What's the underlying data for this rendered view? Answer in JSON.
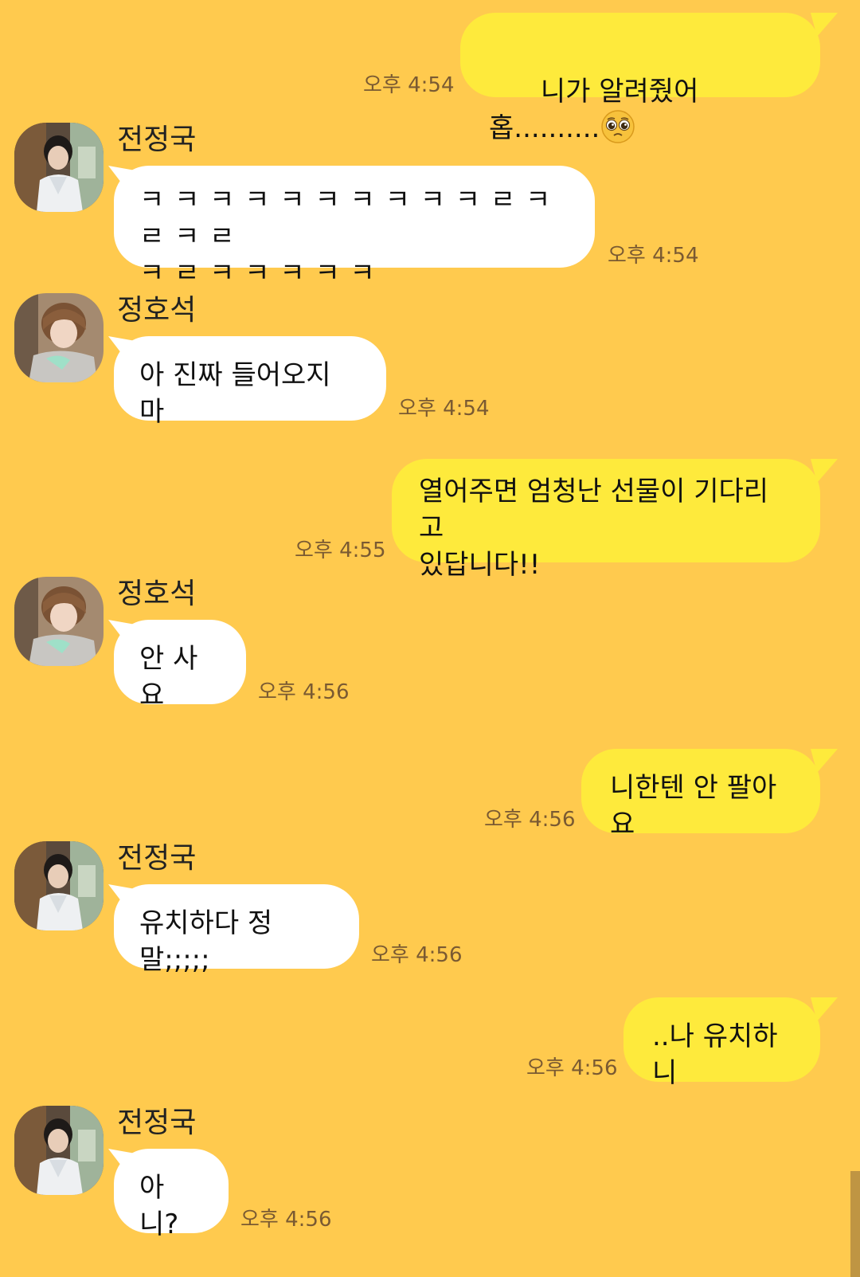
{
  "colors": {
    "background": "#FFCA4E",
    "incoming_bubble": "#FFFFFF",
    "outgoing_bubble": "#FEEA3C",
    "timestamp": "#7a5a32"
  },
  "messages": [
    {
      "direction": "out",
      "text": "니가 알려줬어 홉..........",
      "emoji": "pleading-face-emoji",
      "time": "오후 4:54"
    },
    {
      "direction": "in",
      "sender": "전정국",
      "avatar": "avatar-jeongguk",
      "text": "ㅋ ㅋ ㅋ ㅋ ㅋ ㅋ ㅋ ㅋ ㅋ ㅋ ㄹ ㅋ ㄹ ㅋ ㄹ\nㅋ ㄹ ㅋ ㅋ ㅋ ㅋ ㅋ",
      "time": "오후 4:54"
    },
    {
      "direction": "in",
      "sender": "정호석",
      "avatar": "avatar-hoseok",
      "text": "아 진짜 들어오지 마",
      "time": "오후 4:54"
    },
    {
      "direction": "out",
      "text": "열어주면 엄청난 선물이 기다리고\n있답니다!!",
      "time": "오후 4:55"
    },
    {
      "direction": "in",
      "sender": "정호석",
      "avatar": "avatar-hoseok",
      "text": "안 사요",
      "time": "오후 4:56"
    },
    {
      "direction": "out",
      "text": "니한텐 안 팔아요",
      "time": "오후 4:56"
    },
    {
      "direction": "in",
      "sender": "전정국",
      "avatar": "avatar-jeongguk",
      "text": "유치하다 정말;;;;;",
      "time": "오후 4:56"
    },
    {
      "direction": "out",
      "text": "..나 유치하니",
      "time": "오후 4:56"
    },
    {
      "direction": "in",
      "sender": "전정국",
      "avatar": "avatar-jeongguk",
      "text": "아니?",
      "time": "오후 4:56"
    }
  ]
}
